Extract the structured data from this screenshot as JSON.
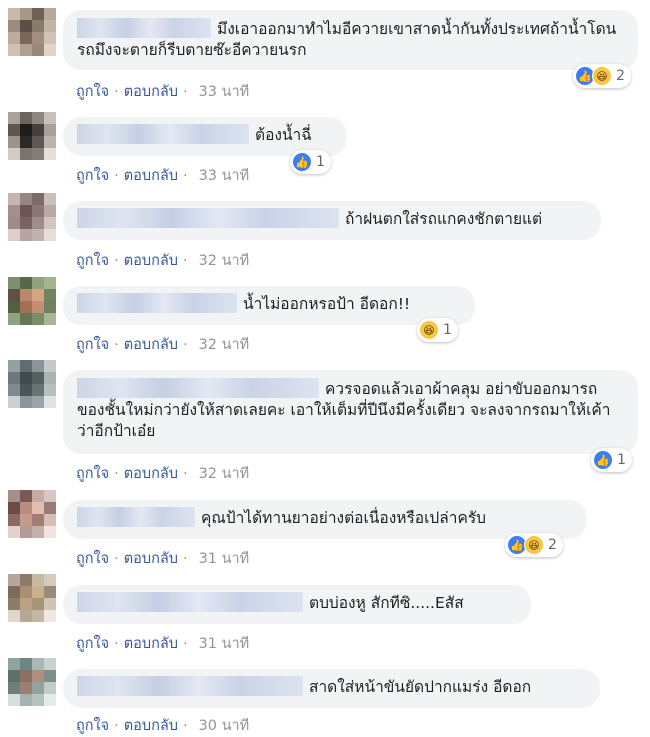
{
  "reply_label": "ตอบกลับ",
  "like_label": "ถูกใจ",
  "separator": "·",
  "comments": [
    {
      "text": "มึงเอาออกมาทำไมอีควายเขาสาดน้ำกันทั้งประเทศถ้าน้ำโดนรถมึงจะตายก็รีบตายซ๊ะอีควายนรก",
      "time": "33 นาที",
      "reaction_count": "2",
      "reactions": [
        "like-icon",
        "haha-icon"
      ]
    },
    {
      "text": "ต้องน้ำฉี่",
      "time": "33 นาที",
      "reaction_count": "1",
      "reactions": [
        "like-icon"
      ]
    },
    {
      "text": "ถ้าฝนตกใส่รถแกคงชักตายแต่",
      "time": "32 นาที",
      "reaction_count": "",
      "reactions": []
    },
    {
      "text": "น้ำไม่ออกหรอป้า อีดอก!!",
      "time": "32 นาที",
      "reaction_count": "1",
      "reactions": [
        "haha-icon"
      ]
    },
    {
      "text": "ควรจอดแล้วเอาผ้าคลุม อย่าขับออกมารถของชั้นใหม่กว่ายังให้สาดเลยคะ เอาให้เต็มที่ปีนึงมีครั้งเดียว จะลงจากรถมาให้เค้าว่าอีกป้าเอ๋ย",
      "time": "32 นาที",
      "reaction_count": "1",
      "reactions": [
        "like-icon"
      ]
    },
    {
      "text": "คุณป้าได้ทานยาอย่างต่อเนื่องหรือเปล่าครับ",
      "time": "31 นาที",
      "reaction_count": "2",
      "reactions": [
        "like-icon",
        "haha-icon"
      ]
    },
    {
      "text": "ตบบ่องหู สักทีซิ.....Eสัส",
      "time": "31 นาที",
      "reaction_count": "",
      "reactions": []
    },
    {
      "text": "สาดใส่หน้าขันยัดปากแมร่ง อีดอก",
      "time": "30 นาที",
      "reaction_count": "",
      "reactions": []
    }
  ],
  "avatar_colors": [
    [
      "#c8b9a8",
      "#a89888",
      "#6e6154",
      "#b8a898",
      "#9c8c7c",
      "#5c4f45",
      "#8a7a6a",
      "#c4b4a4",
      "#bcac9c",
      "#786858",
      "#a08f80",
      "#d0c2b4",
      "#cfc0b0",
      "#b0a090",
      "#988878",
      "#e0d4c8"
    ],
    [
      "#a9a29b",
      "#6b645e",
      "#8d8680",
      "#c6c0ba",
      "#5d5550",
      "#1f1c1a",
      "#454040",
      "#a7a19b",
      "#9b948d",
      "#2c2826",
      "#5e5854",
      "#bab4ae",
      "#d1cbc5",
      "#7b746e",
      "#847d77",
      "#e4dfda"
    ],
    [
      "#c4b7b3",
      "#978682",
      "#7d6b69",
      "#cbbebb",
      "#a58f8d",
      "#6c5553",
      "#8d7573",
      "#b9a9a6",
      "#9e8a89",
      "#7a6462",
      "#a08c8a",
      "#d2c5c2",
      "#dccfcc",
      "#b7a5a3",
      "#c1b1ae",
      "#e6dcda"
    ],
    [
      "#7b8f6c",
      "#55694a",
      "#8ea47f",
      "#a3b48f",
      "#5e5044",
      "#b9876a",
      "#d4a57f",
      "#70845f",
      "#4f6140",
      "#a36f55",
      "#c29070",
      "#6e8160",
      "#8fa37e",
      "#647653",
      "#7a8d69",
      "#a7b794"
    ],
    [
      "#94a0a2",
      "#5f6d70",
      "#8a9597",
      "#c3cacb",
      "#6c787a",
      "#3f4a4c",
      "#56615f",
      "#aab4b5",
      "#7f8a8c",
      "#4a5557",
      "#687473",
      "#b6bebf",
      "#cbd1d2",
      "#8c9698",
      "#9aa3a5",
      "#dde2e2"
    ],
    [
      "#a88e8a",
      "#7a5a55",
      "#c9aaa2",
      "#d8c6c2",
      "#6e4a44",
      "#ba8d82",
      "#e0bfb2",
      "#9a7a74",
      "#8c6a64",
      "#c49a8e",
      "#a37d74",
      "#d6beb6",
      "#e2d2cd",
      "#b39a94",
      "#c6b0aa",
      "#efe4e0"
    ],
    [
      "#b5a89a",
      "#8c7b6a",
      "#c8b8a6",
      "#d6cbbf",
      "#7d6a58",
      "#a89070",
      "#c9b08e",
      "#9a8a78",
      "#8e7c68",
      "#b8a384",
      "#a69378",
      "#d2c4b2",
      "#e0d6ca",
      "#b6a794",
      "#c4b7a6",
      "#eee8e0"
    ],
    [
      "#8fa3a0",
      "#6c8581",
      "#a7b8b5",
      "#c9d2d0",
      "#5e706c",
      "#8a6f62",
      "#b08e7d",
      "#7c8f8b",
      "#6d7f7b",
      "#9c7f70",
      "#92a29f",
      "#c2ccca",
      "#d7dedd",
      "#a4b2b0",
      "#b6c2c0",
      "#e6ebea"
    ]
  ]
}
